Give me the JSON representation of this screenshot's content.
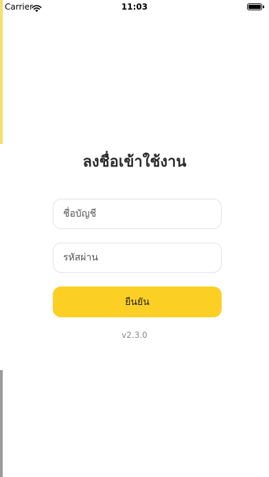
{
  "status_bar": {
    "carrier": "Carrier",
    "time": "11:03"
  },
  "login": {
    "title": "ลงชื่อเข้าใช้งาน",
    "username_placeholder": "ชื่อบัญชี",
    "password_placeholder": "รหัสผ่าน",
    "submit_label": "ยืนยัน",
    "version": "v2.3.0"
  },
  "colors": {
    "accent": "#fccf24",
    "accent_edge": "#f8df6a",
    "field_border": "#e2e2e2",
    "text": "#2a2a2a",
    "muted": "#888888"
  },
  "icons": {
    "wifi": "wifi-icon",
    "battery": "battery-icon"
  }
}
